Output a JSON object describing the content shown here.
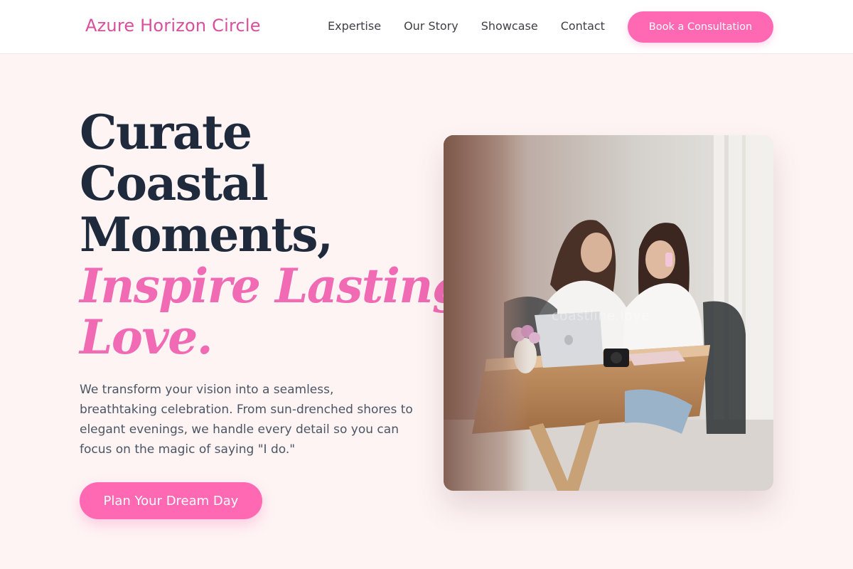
{
  "header": {
    "brand": "Azure Horizon Circle",
    "nav": [
      "Expertise",
      "Our Story",
      "Showcase",
      "Contact"
    ],
    "cta_label": "Book a Consultation"
  },
  "hero": {
    "headline_lines": [
      "Curate",
      "Coastal",
      "Moments,"
    ],
    "accent_lines": [
      "Inspire Lasting",
      "Love."
    ],
    "description": "We transform your vision into a seamless, breathtaking celebration. From sun-drenched shores to elegant evenings, we handle every detail so you can focus on the magic of saying \"I do.\"",
    "cta_label": "Plan Your Dream Day",
    "image_watermark": "coastline.love"
  },
  "colors": {
    "accent": "#ff69b4",
    "brand_text": "#d94f9c",
    "background": "#fef4f4",
    "heading": "#1f2a3c"
  }
}
